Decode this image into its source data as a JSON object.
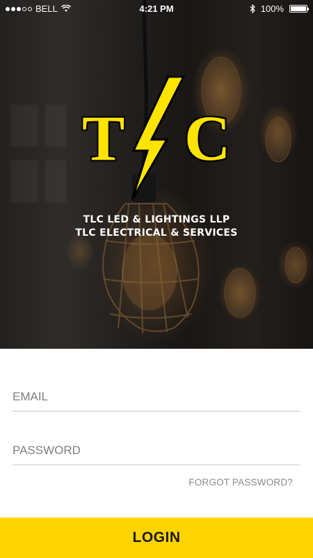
{
  "status_bar": {
    "carrier": "BELL",
    "time": "4:21 PM",
    "battery_percent": "100%",
    "battery_level": 1.0,
    "signal_bars_filled": 3,
    "signal_bars_total": 5
  },
  "brand": {
    "logo_letters": [
      "T",
      "C"
    ],
    "line1": "TLC LED & LIGHTINGS LLP",
    "line2": "TLC ELECTRICAL & SERVICES",
    "accent_color": "#FFE400"
  },
  "form": {
    "email_placeholder": "EMAIL",
    "password_placeholder": "PASSWORD",
    "forgot_password": "FORGOT PASSWORD?",
    "login_label": "LOGIN",
    "login_color": "#FFD400"
  }
}
